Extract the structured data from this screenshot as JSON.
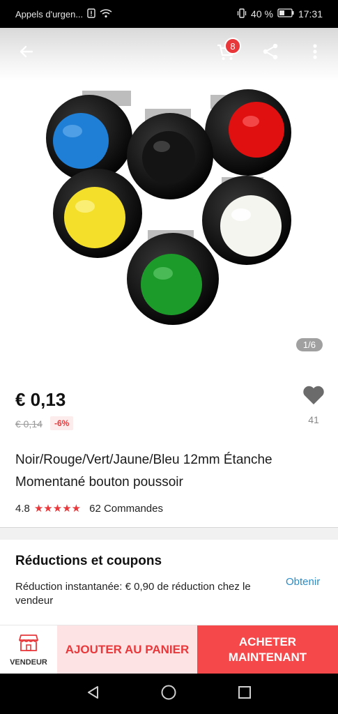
{
  "status_bar": {
    "carrier": "Appels d'urgen...",
    "battery": "40 %",
    "time": "17:31"
  },
  "app_bar": {
    "cart_count": "8",
    "icons": [
      "back-arrow-icon",
      "cart-icon",
      "share-icon",
      "more-vertical-icon"
    ]
  },
  "gallery": {
    "counter": "1/6",
    "button_colors": [
      "#1f7fd6",
      "#111111",
      "#e01010",
      "#f4e02a",
      "#f5f5f0",
      "#1c9a2a"
    ]
  },
  "product": {
    "price": "€ 0,13",
    "old_price": "€ 0,14",
    "discount": "-6%",
    "wishlist_count": "41",
    "title": "Noir/Rouge/Vert/Jaune/Bleu 12mm Étanche Momentané bouton poussoir",
    "rating": "4.8",
    "stars": "★★★★★",
    "orders": "62 Commandes"
  },
  "coupons": {
    "title": "Réductions et coupons",
    "text": "Réduction instantanée: € 0,90 de réduction chez le vendeur",
    "link": "Obtenir"
  },
  "actions": {
    "seller": "VENDEUR",
    "add_to_cart": "AJOUTER AU PANIER",
    "buy_now": "ACHETER MAINTENANT"
  },
  "colors": {
    "accent": "#e8383b",
    "link": "#2a8cc7"
  }
}
